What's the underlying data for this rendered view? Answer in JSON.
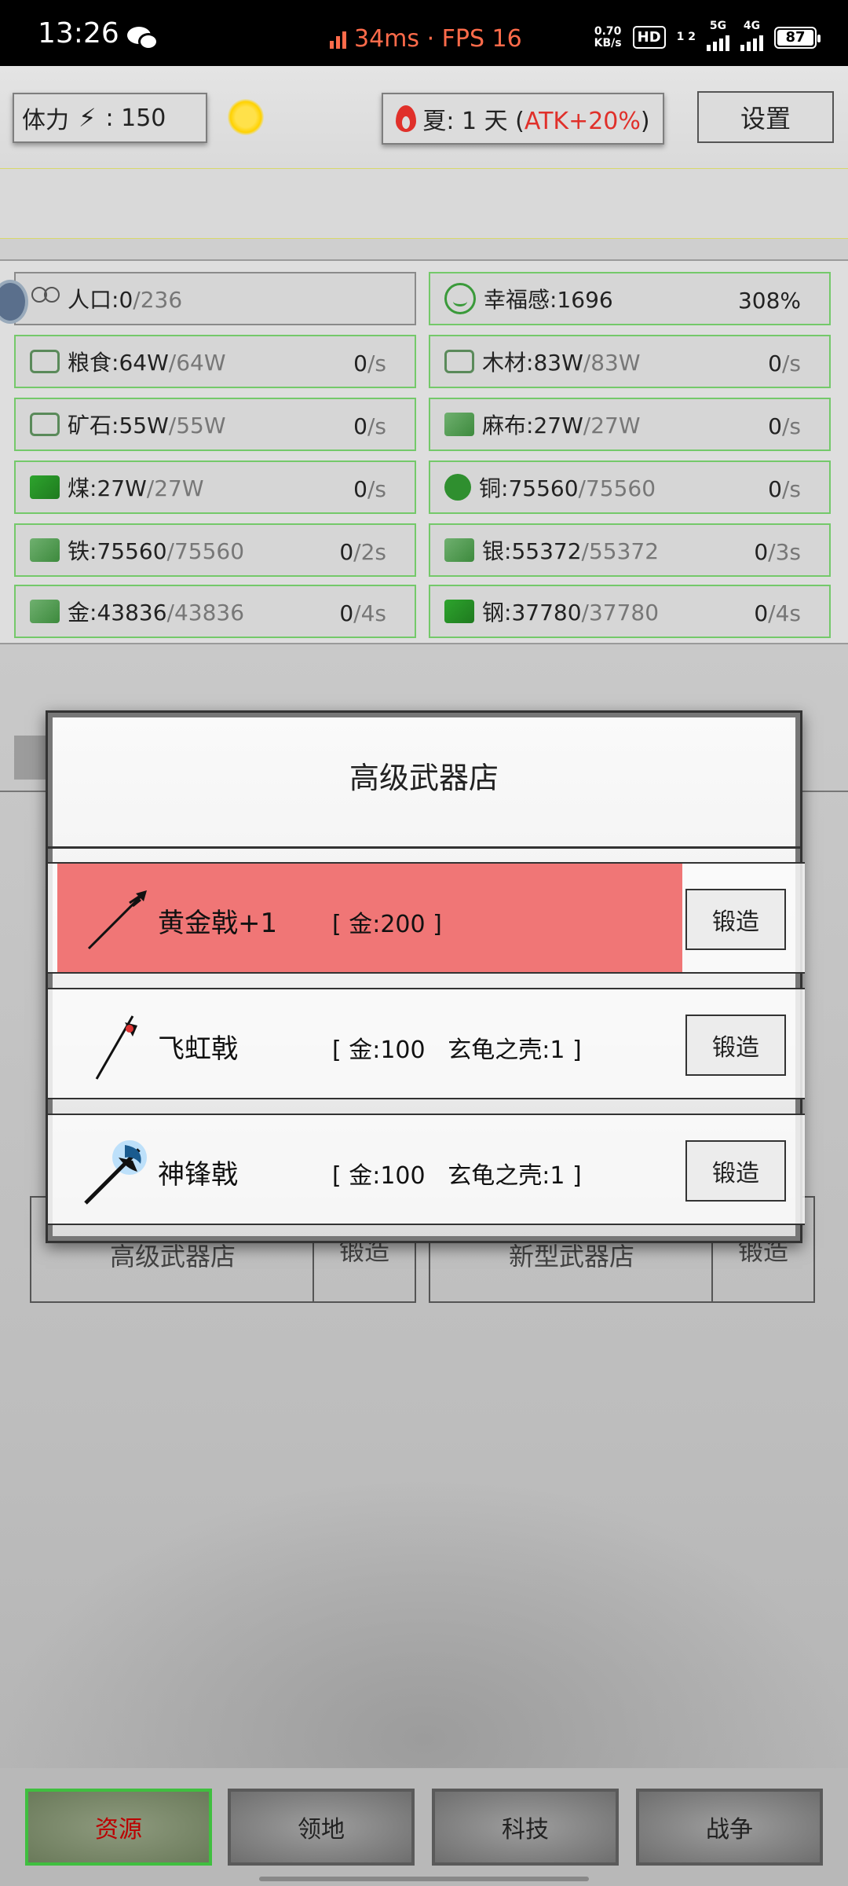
{
  "status_bar": {
    "time": "13:26",
    "latency": "34ms · FPS 16",
    "net_speed_value": "0.70",
    "net_speed_unit": "KB/s",
    "hd": "HD",
    "sim": "1 2",
    "gen1": "5G",
    "gen2": "4G",
    "battery": "87"
  },
  "top_bar": {
    "stamina_label": "体力",
    "stamina_value": ": 150",
    "season_prefix": "夏: 1 天 (",
    "season_bonus": "ATK+20%",
    "season_suffix": ")",
    "settings_label": "设置"
  },
  "resources": [
    {
      "name": "人口:",
      "amount": "0",
      "cap": "/236",
      "rate": "",
      "unit": ""
    },
    {
      "name": "幸福感:1696",
      "amount": "",
      "cap": "",
      "rate": "308%",
      "unit": ""
    },
    {
      "name": "粮食:",
      "amount": "64W",
      "cap": "/64W",
      "rate": "0",
      "unit": "/s"
    },
    {
      "name": "木材:",
      "amount": "83W",
      "cap": "/83W",
      "rate": "0",
      "unit": "/s"
    },
    {
      "name": "矿石:",
      "amount": "55W",
      "cap": "/55W",
      "rate": "0",
      "unit": "/s"
    },
    {
      "name": "麻布:",
      "amount": "27W",
      "cap": "/27W",
      "rate": "0",
      "unit": "/s"
    },
    {
      "name": "煤:",
      "amount": "27W",
      "cap": "/27W",
      "rate": "0",
      "unit": "/s"
    },
    {
      "name": "铜:",
      "amount": "75560",
      "cap": "/75560",
      "rate": "0",
      "unit": "/s"
    },
    {
      "name": "铁:",
      "amount": "75560",
      "cap": "/75560",
      "rate": "0",
      "unit": "/2s"
    },
    {
      "name": "银:",
      "amount": "55372",
      "cap": "/55372",
      "rate": "0",
      "unit": "/3s"
    },
    {
      "name": "金:",
      "amount": "43836",
      "cap": "/43836",
      "rate": "0",
      "unit": "/4s"
    },
    {
      "name": "钢:",
      "amount": "37780",
      "cap": "/37780",
      "rate": "0",
      "unit": "/4s"
    }
  ],
  "background_shops": {
    "left_label": "高级武器店",
    "right_label": "新型武器店",
    "button_label": "锻造"
  },
  "modal": {
    "title": "高级武器店",
    "items": [
      {
        "name": "黄金戟+1",
        "cost": "[ 金:200 ]",
        "button": "锻造",
        "icon": "golden-halberd-icon"
      },
      {
        "name": "飞虹戟",
        "cost": "[ 金:100   玄龟之壳:1 ]",
        "button": "锻造",
        "icon": "rainbow-halberd-icon"
      },
      {
        "name": "神锋戟",
        "cost": "[ 金:100   玄龟之壳:1 ]",
        "button": "锻造",
        "icon": "divine-halberd-icon"
      }
    ]
  },
  "bottom_nav": {
    "tabs": [
      "资源",
      "领地",
      "科技",
      "战争"
    ],
    "active": "资源"
  },
  "colors": {
    "selected_row": "#f07676",
    "resource_border": "#74c96a",
    "atk_text": "#e0302a",
    "status_accent": "#ff6b4a"
  }
}
